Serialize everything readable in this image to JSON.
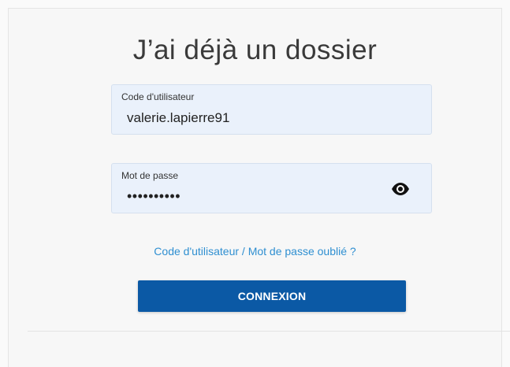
{
  "page": {
    "title": "J’ai déjà un dossier"
  },
  "form": {
    "username": {
      "label": "Code d'utilisateur",
      "value": "valerie.lapierre91"
    },
    "password": {
      "label": "Mot de passe",
      "masked_value": "••••••••••",
      "visibility_icon": "eye-icon"
    },
    "forgot_link": "Code d'utilisateur / Mot de passe oublié ?",
    "submit_label": "CONNEXION"
  },
  "colors": {
    "page_background": "#fafafa",
    "panel_background": "#f7f7f7",
    "field_background": "#eaf1fb",
    "link": "#2f8fd1",
    "button": "#0b59a5",
    "button_text": "#ffffff"
  }
}
